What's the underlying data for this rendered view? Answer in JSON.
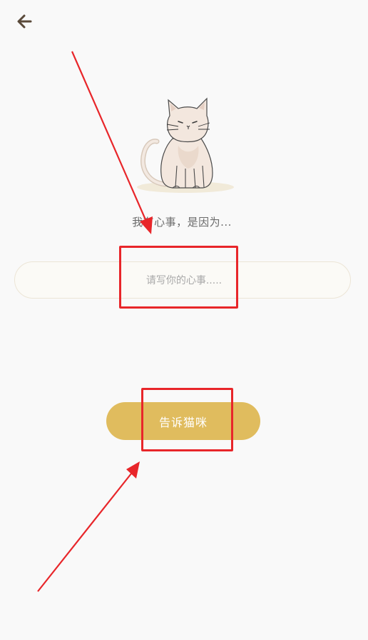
{
  "header": {
    "back_icon": "arrow-left-icon"
  },
  "illustration": {
    "icon": "sitting-cat-icon"
  },
  "prompt": {
    "text": "我有心事，是因为..."
  },
  "input": {
    "placeholder": "请写你的心事.....",
    "value": ""
  },
  "submit": {
    "label": "告诉猫咪"
  },
  "colors": {
    "background": "#f9f9f9",
    "button": "#e0bc5e",
    "input_border": "#ece5d6",
    "annotation": "#e8262a",
    "back_arrow": "#5a4a3a"
  }
}
